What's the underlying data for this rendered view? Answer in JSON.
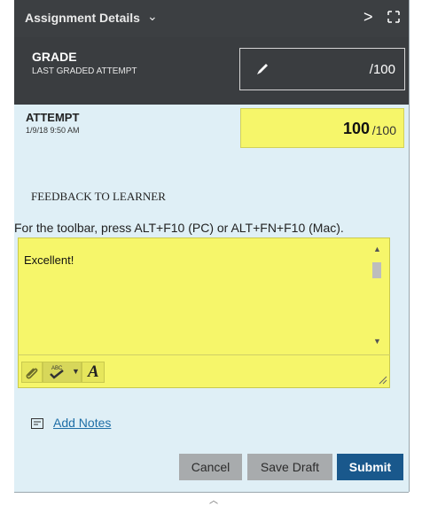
{
  "header": {
    "title": "Assignment Details",
    "title_chevron": "⌄",
    "next_glyph": ">",
    "expand_icon": "expand-icon"
  },
  "grade": {
    "title": "GRADE",
    "subtitle": "LAST GRADED ATTEMPT",
    "value": "/100",
    "edit_icon": "pencil-icon"
  },
  "attempt": {
    "title": "ATTEMPT",
    "date": "1/9/18 9:50 AM",
    "score": "100",
    "score_total": "/100"
  },
  "feedback": {
    "label": "FEEDBACK TO LEARNER",
    "toolbar_hint": "For the toolbar, press ALT+F10 (PC) or ALT+FN+F10 (Mac).",
    "text": "Excellent!"
  },
  "editor_tools": {
    "attach_icon": "paperclip-icon",
    "spellcheck_icon": "spellcheck-icon",
    "dropdown_icon": "chevron-down-icon",
    "format_icon": "text-format-icon",
    "format_glyph": "A"
  },
  "notes": {
    "link": "Add Notes",
    "icon": "notes-icon"
  },
  "buttons": {
    "cancel": "Cancel",
    "save_draft": "Save Draft",
    "submit": "Submit"
  },
  "colors": {
    "header_bg": "#3c3f42",
    "panel_bg": "#dfeff6",
    "highlight": "#f6f66a",
    "submit_bg": "#19588c",
    "link": "#1f6fa7"
  }
}
